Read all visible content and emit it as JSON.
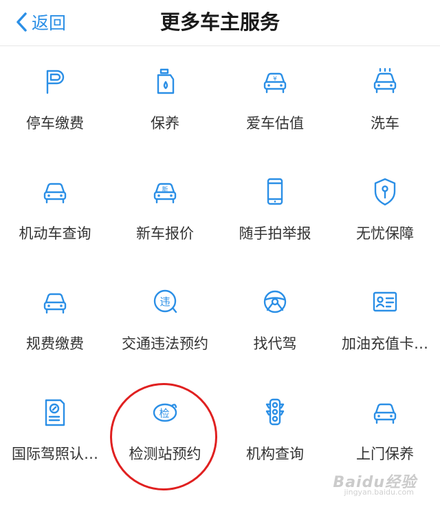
{
  "header": {
    "back_label": "返回",
    "title": "更多车主服务"
  },
  "services": [
    {
      "label": "停车缴费",
      "icon": "parking-icon"
    },
    {
      "label": "保养",
      "icon": "oil-bottle-icon"
    },
    {
      "label": "爱车估值",
      "icon": "car-value-icon"
    },
    {
      "label": "洗车",
      "icon": "car-wash-icon"
    },
    {
      "label": "机动车查询",
      "icon": "car-icon"
    },
    {
      "label": "新车报价",
      "icon": "new-car-icon"
    },
    {
      "label": "随手拍举报",
      "icon": "phone-icon"
    },
    {
      "label": "无忧保障",
      "icon": "shield-icon"
    },
    {
      "label": "规费缴费",
      "icon": "car-icon"
    },
    {
      "label": "交通违法预约",
      "icon": "violation-icon"
    },
    {
      "label": "找代驾",
      "icon": "steering-wheel-icon"
    },
    {
      "label": "加油充值卡…",
      "icon": "card-icon"
    },
    {
      "label": "国际驾照认…",
      "icon": "license-icon"
    },
    {
      "label": "检测站预约",
      "icon": "inspection-icon"
    },
    {
      "label": "机构查询",
      "icon": "traffic-light-icon"
    },
    {
      "label": "上门保养",
      "icon": "car-icon"
    }
  ],
  "icon_glyphs": {
    "new_car": "新",
    "violation": "违",
    "inspection": "检",
    "car_value": "¥"
  },
  "watermark": {
    "text": "Baidu经验",
    "sub": "jingyan.baidu.com"
  },
  "colors": {
    "accent": "#2b8fe6",
    "highlight_circle": "#e02020",
    "text": "#333333"
  }
}
